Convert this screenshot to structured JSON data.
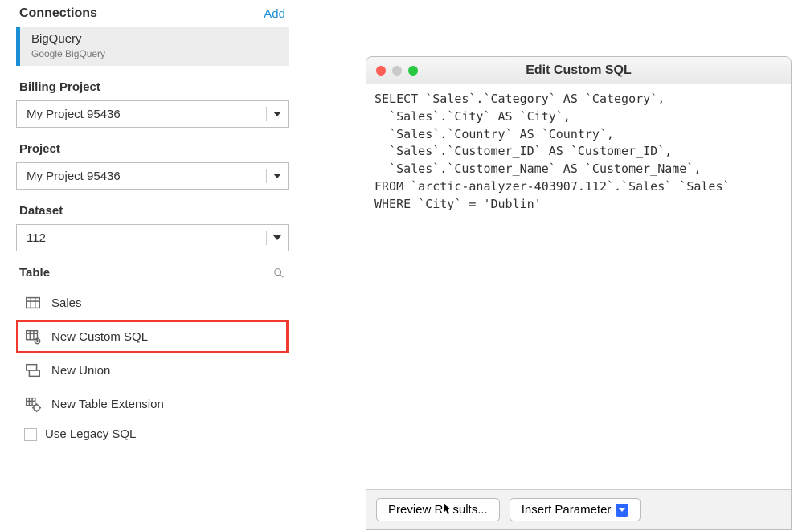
{
  "connections": {
    "header": "Connections",
    "add_label": "Add",
    "items": [
      {
        "name": "BigQuery",
        "sub": "Google BigQuery"
      }
    ]
  },
  "fields": {
    "billing_project": {
      "label": "Billing Project",
      "value": "My Project 95436"
    },
    "project": {
      "label": "Project",
      "value": "My Project 95436"
    },
    "dataset": {
      "label": "Dataset",
      "value": "112"
    }
  },
  "table_section": {
    "label": "Table",
    "items": [
      {
        "label": "Sales"
      },
      {
        "label": "New Custom SQL"
      },
      {
        "label": "New Union"
      },
      {
        "label": "New Table Extension"
      }
    ],
    "use_legacy_label": "Use Legacy SQL"
  },
  "dialog": {
    "title": "Edit Custom SQL",
    "sql": "SELECT `Sales`.`Category` AS `Category`,\n  `Sales`.`City` AS `City`,\n  `Sales`.`Country` AS `Country`,\n  `Sales`.`Customer_ID` AS `Customer_ID`,\n  `Sales`.`Customer_Name` AS `Customer_Name`,\nFROM `arctic-analyzer-403907.112`.`Sales` `Sales`\nWHERE `City` = 'Dublin'",
    "preview_label": "Preview R sults...",
    "insert_label": "Insert Parameter"
  }
}
